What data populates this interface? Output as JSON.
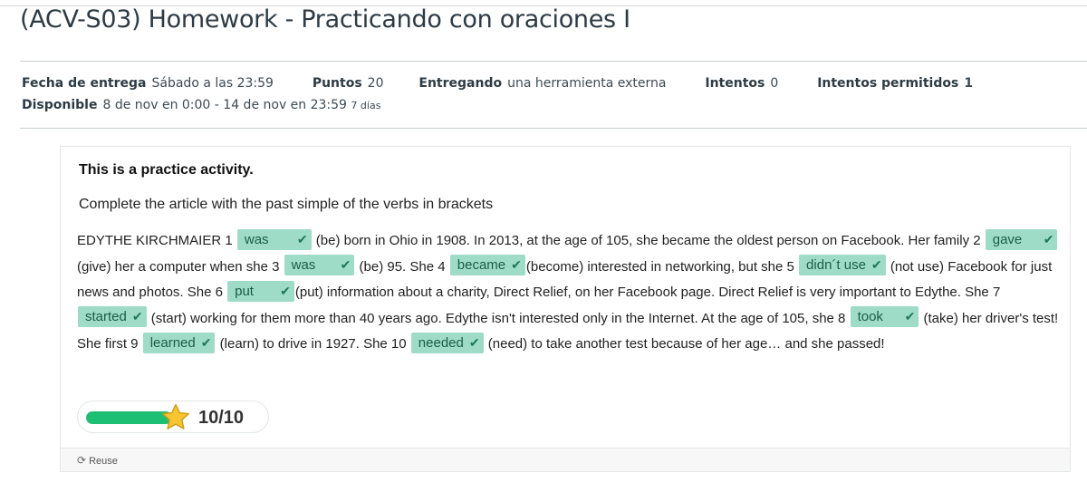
{
  "assignment": {
    "title": "(ACV-S03) Homework - Practicando con oraciones I",
    "details": {
      "due_label": "Fecha de entrega",
      "due_value": "Sábado a las 23:59",
      "points_label": "Puntos",
      "points_value": "20",
      "submitting_label": "Entregando",
      "submitting_value": "una herramienta externa",
      "attempts_label": "Intentos",
      "attempts_value": "0",
      "allowed_label": "Intentos permitidos",
      "allowed_value": "1",
      "available_label": "Disponible",
      "available_value": "8 de nov en 0:00 - 14 de nov en 23:59",
      "available_days": "7 días"
    }
  },
  "activity": {
    "heading": "This is a practice activity.",
    "instructions": "Complete the article with the past simple of the verbs in brackets",
    "text": {
      "t0": "EDYTHE KIRCHMAIER 1",
      "a1": "was",
      "t1": "(be) born in Ohio in 1908. In 2013, at the age of 105, she became the oldest person on Facebook. Her family 2",
      "a2": "gave",
      "t2": "(give) her a computer when she 3",
      "a3": "was",
      "t3": "(be) 95. She 4",
      "a4": "became",
      "t4": "(become) interested in networking, but she 5",
      "a5": "didn´t use",
      "t5": "(not use) Facebook for just news and photos. She 6",
      "a6": "put",
      "t6": "(put) information about a charity, Direct Relief, on her Facebook page. Direct Relief is very important to Edythe. She 7",
      "a7": "started",
      "t7": "(start) working for them more than 40 years ago. Edythe isn't interested only in the Internet. At the age of 105, she 8",
      "a8": "took",
      "t8": "(take) her driver's test! She first 9",
      "a9": "learned",
      "t9": "(learn) to drive in 1927. She 10",
      "a10": "needed",
      "t10": "(need) to take another test because of her age… and she passed!"
    },
    "score": {
      "text": "10/10",
      "fraction": 1.0,
      "fill_color": "#1dbf73"
    },
    "footer": {
      "reuse_label": "Reuse",
      "reuse_icon": "refresh-icon"
    },
    "colors": {
      "blank_bg": "#9fdcc7",
      "check": "#1c7a58"
    }
  }
}
